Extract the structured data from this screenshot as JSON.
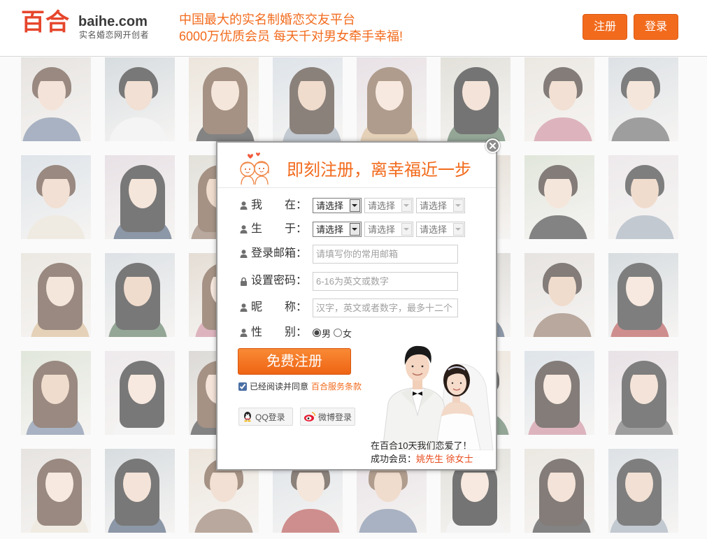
{
  "header": {
    "logo_cn": "百合",
    "logo_domain": "baihe.com",
    "logo_slogan": "实名婚恋网开创者",
    "tagline_1": "中国最大的实名制婚恋交友平台",
    "tagline_2": "6000万优质会员 每天千对男女牵手幸福!",
    "register_label": "注册",
    "login_label": "登录"
  },
  "modal": {
    "title": "即刻注册，离幸福近一步",
    "location": {
      "label": "我　　在：",
      "selects": [
        "请选择",
        "请选择",
        "请选择"
      ]
    },
    "birth": {
      "label": "生　　于：",
      "selects": [
        "请选择",
        "请选择",
        "请选择"
      ]
    },
    "email": {
      "label": "登录邮箱：",
      "placeholder": "请填写你的常用邮箱",
      "value": ""
    },
    "password": {
      "label": "设置密码：",
      "placeholder": "6-16为英文或数字",
      "value": ""
    },
    "nickname": {
      "label": "昵　　称：",
      "placeholder": "汉字，英文或者数字，最多十二个",
      "value": ""
    },
    "gender": {
      "label": "性　　别：",
      "options": [
        "男",
        "女"
      ],
      "selected_index": 0
    },
    "submit_label": "免费注册",
    "agree": {
      "checked": true,
      "text": "已经阅读并同意",
      "link": "百合服务条款"
    },
    "social": {
      "qq": "QQ登录",
      "weibo": "微博登录"
    },
    "story": {
      "caption": "在百合10天我们恋爱了！",
      "members_label": "成功会员：",
      "member_1": "姚先生",
      "member_2": "徐女士"
    }
  },
  "icons": {
    "couple": "couple-cartoon-icon",
    "close": "close-icon",
    "person": "person-icon",
    "lock": "lock-icon",
    "dropdown": "dropdown-arrow-icon",
    "qq": "qq-icon",
    "weibo": "weibo-icon"
  },
  "colors": {
    "brand_orange": "#f26b1d",
    "logo_red": "#e6462c",
    "member_name": "#e84c1d"
  }
}
